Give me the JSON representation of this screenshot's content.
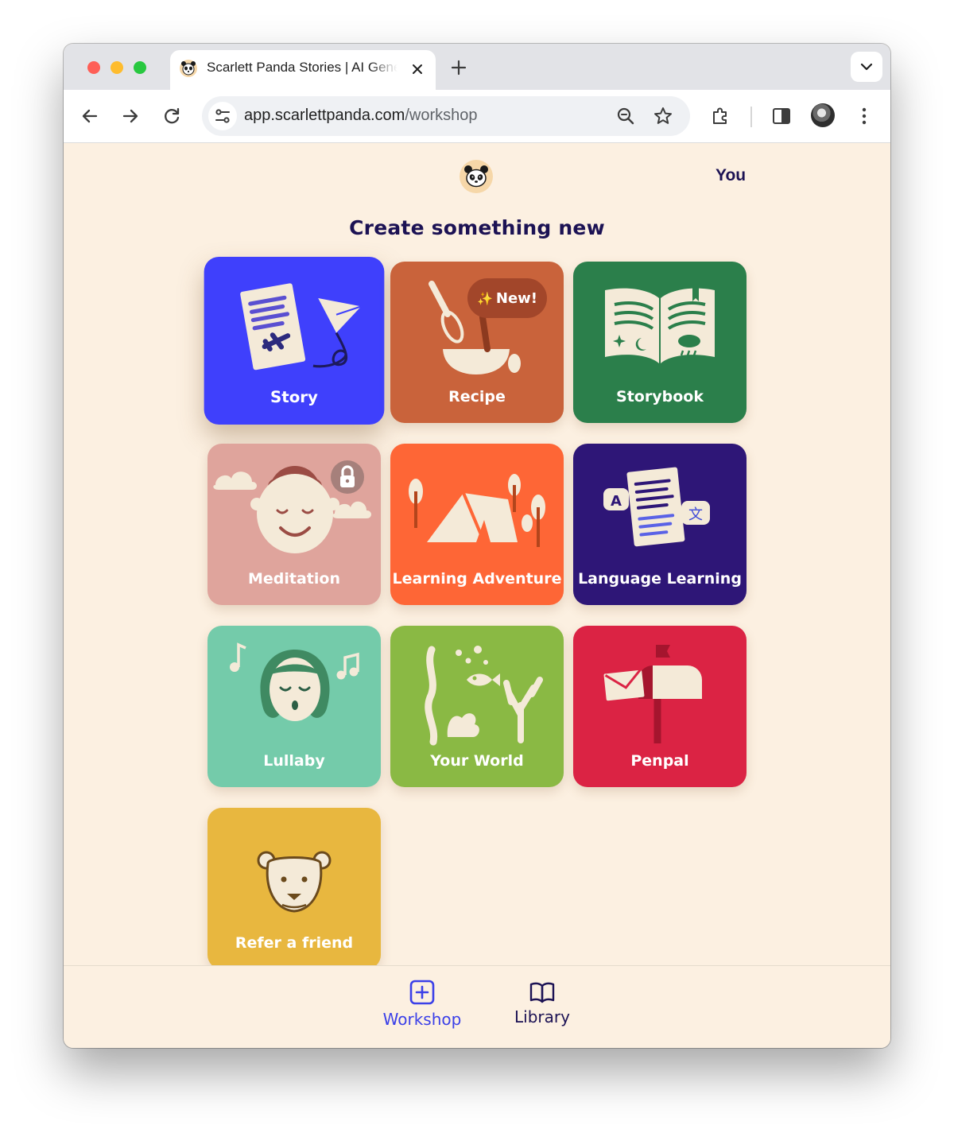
{
  "browser": {
    "tab_title": "Scarlett Panda Stories | AI Generated Stories",
    "url_host": "app.scarlettpanda.com",
    "url_path": "/workshop"
  },
  "header": {
    "user_link": "You"
  },
  "main": {
    "heading": "Create something new",
    "cards": [
      {
        "label": "Story",
        "color": "#3f40fc"
      },
      {
        "label": "Recipe",
        "color": "#c9633b",
        "badge": "New!"
      },
      {
        "label": "Storybook",
        "color": "#2b7f4b"
      },
      {
        "label": "Meditation",
        "color": "#dfa49c",
        "locked": true
      },
      {
        "label": "Learning Adventure",
        "color": "#fe6636"
      },
      {
        "label": "Language Learning",
        "color": "#2e1677"
      },
      {
        "label": "Lullaby",
        "color": "#74cbaa"
      },
      {
        "label": "Your World",
        "color": "#8ab944"
      },
      {
        "label": "Penpal",
        "color": "#db2344"
      },
      {
        "label": "Refer a friend",
        "color": "#e8b73f"
      }
    ]
  },
  "bottom_nav": {
    "workshop_label": "Workshop",
    "library_label": "Library",
    "active_color": "#3b40e8",
    "inactive_color": "#1c1254"
  }
}
